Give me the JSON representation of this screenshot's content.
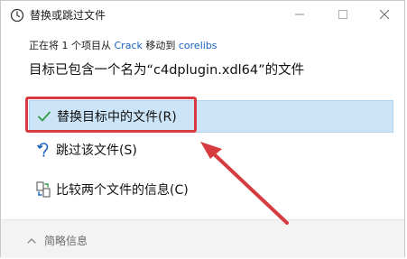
{
  "window": {
    "title": "替换或跳过文件",
    "icons": {
      "title": "clock-icon",
      "minimize": "minimize-icon",
      "maximize": "maximize-icon",
      "close": "close-icon"
    }
  },
  "status": {
    "prefix": "正在将 1 个项目从 ",
    "source": "Crack",
    "middle": " 移动到 ",
    "destination": "corelibs"
  },
  "message": "目标已包含一个名为“c4dplugin.xdl64”的文件",
  "options": [
    {
      "label": "替换目标中的文件(R)",
      "icon": "checkmark-icon",
      "selected": true
    },
    {
      "label": "跳过该文件(S)",
      "icon": "skip-icon",
      "selected": false
    },
    {
      "label": "比较两个文件的信息(C)",
      "icon": "compare-icon",
      "selected": false
    }
  ],
  "footer": {
    "details_label": "简略信息",
    "icon": "chevron-up-icon"
  },
  "colors": {
    "selected_bg": "#cce4f7",
    "link": "#1a63c2",
    "annotation_red": "#d63b3f",
    "footer_bg": "#f3f3f3"
  }
}
